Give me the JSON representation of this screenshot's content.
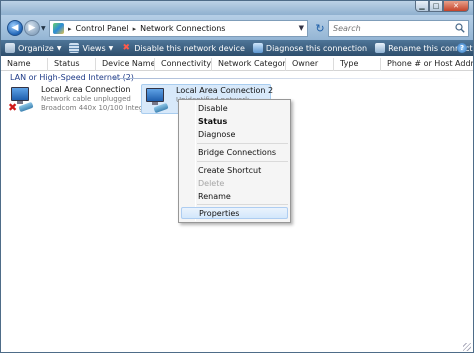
{
  "window": {
    "caption_buttons": [
      "minimize",
      "maximize",
      "close"
    ]
  },
  "address": {
    "segments": [
      "Control Panel",
      "Network Connections"
    ],
    "separator": "▸"
  },
  "search": {
    "placeholder": "Search"
  },
  "toolbar": {
    "organize": "Organize",
    "views": "Views",
    "disable": "Disable this network device",
    "diagnose": "Diagnose this connection",
    "rename": "Rename this connection"
  },
  "columns": [
    "Name",
    "Status",
    "Device Name",
    "Connectivity",
    "Network Category",
    "Owner",
    "Type",
    "Phone # or Host Addre"
  ],
  "group": {
    "title": "LAN or High-Speed Internet (2)"
  },
  "items": [
    {
      "name": "Local Area Connection",
      "status": "Network cable unplugged",
      "device": "Broadcom 440x 10/100 Integ..."
    },
    {
      "name": "Local Area Connection 2",
      "status": "Unidentified network"
    }
  ],
  "context_menu": {
    "disable": "Disable",
    "status": "Status",
    "diagnose": "Diagnose",
    "bridge": "Bridge Connections",
    "shortcut": "Create Shortcut",
    "delete": "Delete",
    "rename": "Rename",
    "properties": "Properties"
  },
  "colors": {
    "toolbar": "#3a5f80",
    "group_title": "#1e3a87",
    "selection": "#d8e9fa",
    "error_x": "#d01818"
  },
  "icons": [
    "back-arrow-icon",
    "forward-arrow-icon",
    "control-panel-icon",
    "refresh-icon",
    "search-icon",
    "organize-icon",
    "views-icon",
    "disable-icon",
    "diagnose-icon",
    "rename-icon",
    "help-icon",
    "network-adapter-icon",
    "disconnected-x-icon"
  ]
}
